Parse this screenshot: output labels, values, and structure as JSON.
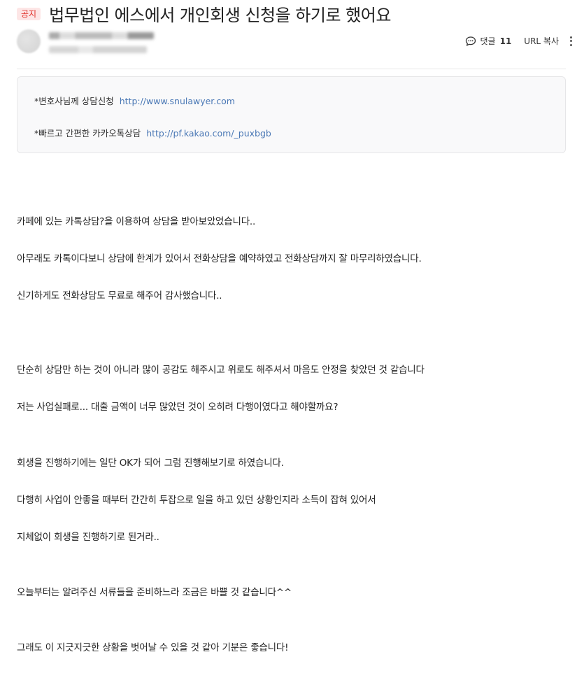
{
  "post": {
    "badge": "공지",
    "title": "법무법인 에스에서 개인회생 신청을 하기로 했어요"
  },
  "meta": {
    "comment_label": "댓글",
    "comment_count": "11",
    "url_copy": "URL 복사",
    "comment_icon": "speech-bubble-icon",
    "more_icon": "vertical-ellipsis-icon"
  },
  "info_box": {
    "line1_prefix": "*변호사님께 상담신청",
    "line1_link": "http://www.snulawyer.com",
    "line2_prefix": "*빠르고 간편한 카카오톡상담",
    "line2_link": "http://pf.kakao.com/_puxbgb"
  },
  "body": {
    "paragraphs": [
      "카페에 있는 카톡상담?을 이용하여 상담을 받아보았었습니다..",
      "아무래도 카톡이다보니 상담에 한계가 있어서 전화상담을 예약하였고 전화상담까지 잘 마무리하였습니다.",
      "신기하게도 전화상담도 무료로 해주어 감사했습니다..",
      "단순히 상담만 하는 것이 아니라 많이 공감도 해주시고 위로도 해주셔서 마음도 안정을 찾았던 것 같습니다",
      "저는 사업실패로... 대출 금액이 너무 많았던 것이 오히려 다행이였다고 해야할까요?",
      "회생을 진행하기에는 일단 OK가 되어 그럼 진행해보기로 하였습니다.",
      "다행히 사업이 안좋을 때부터 간간히 투잡으로 일을 하고 있던 상황인지라 소득이 잡혀 있어서",
      "지체없이 회생을 진행하기로 된거라..",
      "오늘부터는 알려주신 서류들을 준비하느라 조금은 바쁠 것 같습니다^^",
      "그래도 이 지긋지긋한 상황을 벗어날 수 있을 것 같아 기분은 좋습니다!"
    ]
  },
  "colors": {
    "badge_bg": "#fde6e6",
    "badge_text": "#e0322b",
    "link": "#4a78b5",
    "box_bg": "#f9f9fa"
  }
}
